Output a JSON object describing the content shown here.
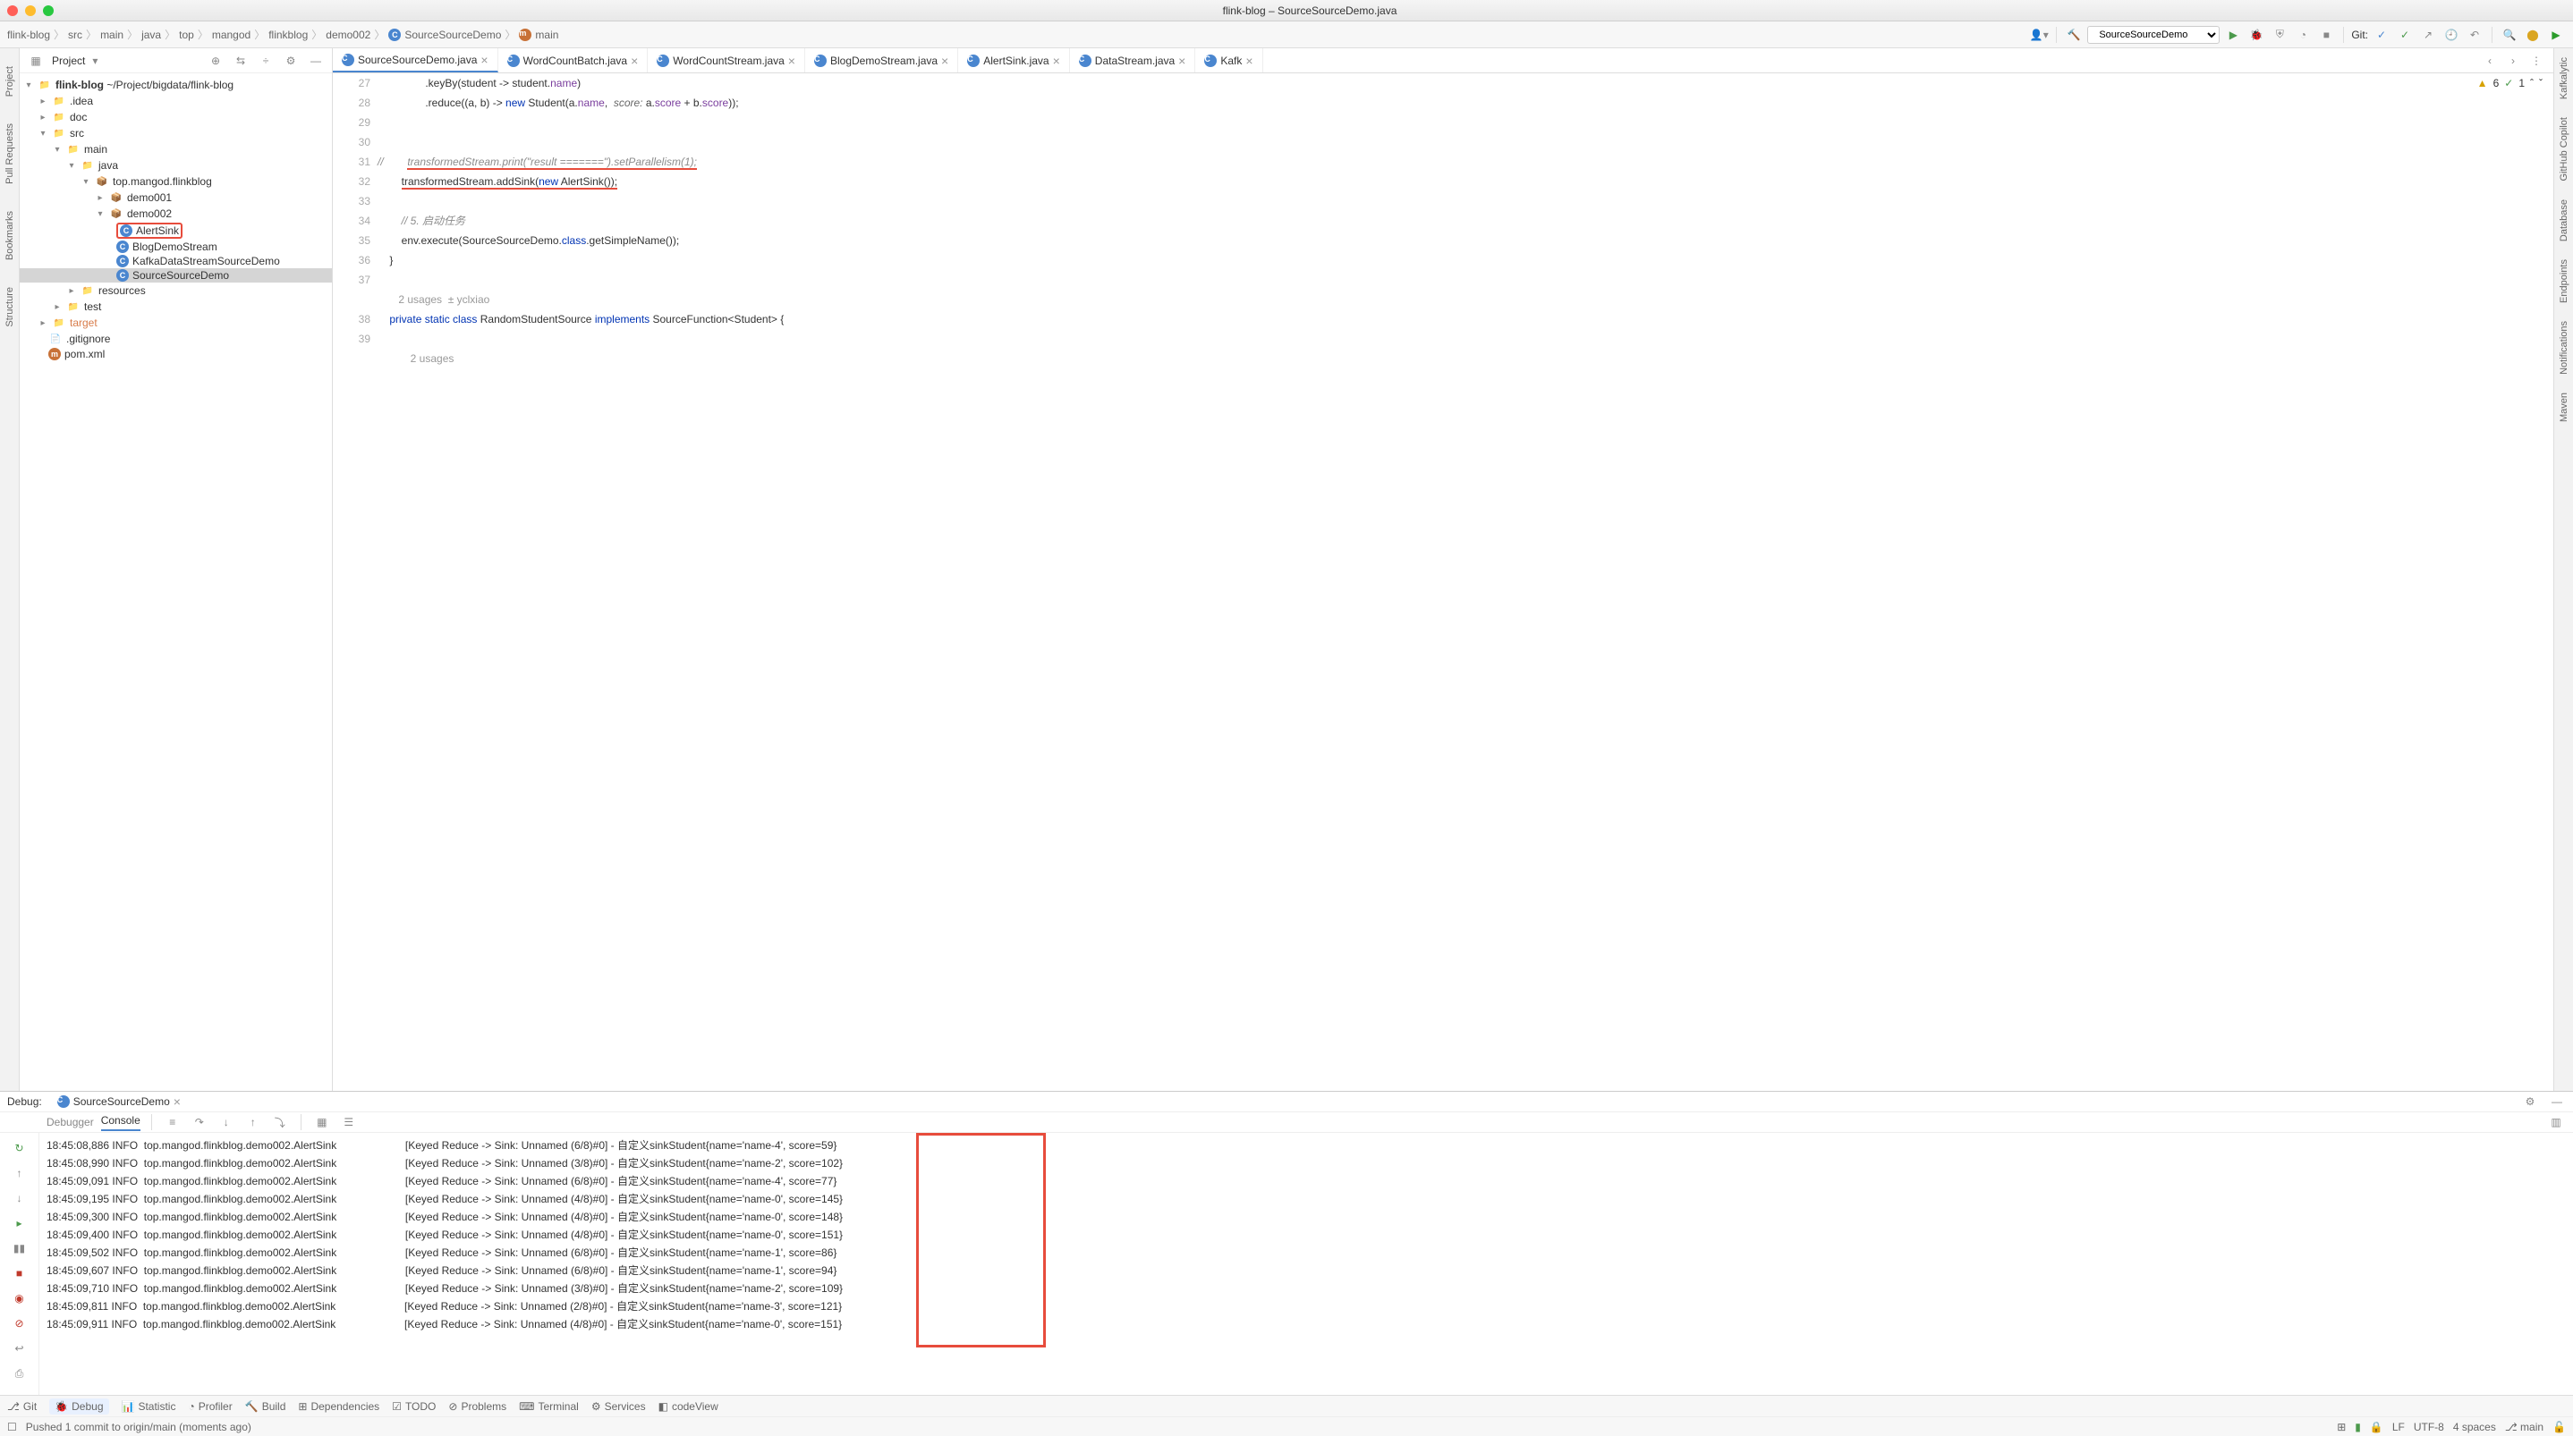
{
  "window": {
    "title": "flink-blog – SourceSourceDemo.java"
  },
  "breadcrumb": [
    "flink-blog",
    "src",
    "main",
    "java",
    "top",
    "mangod",
    "flinkblog",
    "demo002",
    "SourceSourceDemo",
    "main"
  ],
  "run_config": "SourceSourceDemo",
  "git_label": "Git:",
  "tabs": [
    {
      "label": "SourceSourceDemo.java",
      "active": true
    },
    {
      "label": "WordCountBatch.java",
      "active": false
    },
    {
      "label": "WordCountStream.java",
      "active": false
    },
    {
      "label": "BlogDemoStream.java",
      "active": false
    },
    {
      "label": "AlertSink.java",
      "active": false
    },
    {
      "label": "DataStream.java",
      "active": false
    },
    {
      "label": "Kafk",
      "active": false
    }
  ],
  "project_panel_title": "Project",
  "tree": {
    "root": "flink-blog",
    "root_path": "~/Project/bigdata/flink-blog",
    "items": [
      ".idea",
      "doc",
      "src",
      "main",
      "java",
      "top.mangod.flinkblog",
      "demo001",
      "demo002",
      "AlertSink",
      "BlogDemoStream",
      "KafkaDataStreamSourceDemo",
      "SourceSourceDemo",
      "resources",
      "test",
      "target",
      ".gitignore",
      "pom.xml"
    ]
  },
  "editor_widgets": {
    "warnings": "6",
    "ok": "1"
  },
  "code_lines": [
    {
      "n": 27,
      "html": "                .keyBy(student -> student.<span class='ident'>name</span>)"
    },
    {
      "n": 28,
      "html": "                .reduce((a, b) -> <span class='kw'>new</span> Student(a.<span class='ident'>name</span>,  <span class='param'>score:</span> a.<span class='ident'>score</span> + b.<span class='ident'>score</span>));"
    },
    {
      "n": 29,
      "html": ""
    },
    {
      "n": 30,
      "html": ""
    },
    {
      "n": 31,
      "html": "<span class='comment'>//        </span><span class='comment underline-red'>transformedStream.print(\"result =======\").setParallelism(1);</span>"
    },
    {
      "n": 32,
      "html": "        <span class='underline-red'>transformedStream.addSink(<span class='kw'>new</span> AlertSink());</span>"
    },
    {
      "n": 33,
      "html": ""
    },
    {
      "n": 34,
      "html": "        <span class='comment'>// 5. 启动任务</span>"
    },
    {
      "n": 35,
      "html": "        env.execute(SourceSourceDemo.<span class='kw'>class</span>.getSimpleName());"
    },
    {
      "n": 36,
      "html": "    }"
    },
    {
      "n": 37,
      "html": ""
    },
    {
      "n": 0,
      "html": "<span class='code-hint'>    2 usages  ± yclxiao</span>"
    },
    {
      "n": 38,
      "html": "    <span class='kw'>private static class</span> RandomStudentSource <span class='kw'>implements</span> SourceFunction&lt;Student&gt; {"
    },
    {
      "n": 39,
      "html": ""
    },
    {
      "n": 0,
      "html": "<span class='code-hint'>        2 usages</span>"
    }
  ],
  "debug": {
    "label": "Debug:",
    "config": "SourceSourceDemo",
    "tabs": {
      "debugger": "Debugger",
      "console": "Console"
    },
    "console_lines": [
      "18:45:08,886 INFO  top.mangod.flinkblog.demo002.AlertSink                       [Keyed Reduce -> Sink: Unnamed (6/8)#0] - 自定义sinkStudent{name='name-4', score=59}",
      "18:45:08,990 INFO  top.mangod.flinkblog.demo002.AlertSink                       [Keyed Reduce -> Sink: Unnamed (3/8)#0] - 自定义sinkStudent{name='name-2', score=102}",
      "18:45:09,091 INFO  top.mangod.flinkblog.demo002.AlertSink                       [Keyed Reduce -> Sink: Unnamed (6/8)#0] - 自定义sinkStudent{name='name-4', score=77}",
      "18:45:09,195 INFO  top.mangod.flinkblog.demo002.AlertSink                       [Keyed Reduce -> Sink: Unnamed (4/8)#0] - 自定义sinkStudent{name='name-0', score=145}",
      "18:45:09,300 INFO  top.mangod.flinkblog.demo002.AlertSink                       [Keyed Reduce -> Sink: Unnamed (4/8)#0] - 自定义sinkStudent{name='name-0', score=148}",
      "18:45:09,400 INFO  top.mangod.flinkblog.demo002.AlertSink                       [Keyed Reduce -> Sink: Unnamed (4/8)#0] - 自定义sinkStudent{name='name-0', score=151}",
      "18:45:09,502 INFO  top.mangod.flinkblog.demo002.AlertSink                       [Keyed Reduce -> Sink: Unnamed (6/8)#0] - 自定义sinkStudent{name='name-1', score=86}",
      "18:45:09,607 INFO  top.mangod.flinkblog.demo002.AlertSink                       [Keyed Reduce -> Sink: Unnamed (6/8)#0] - 自定义sinkStudent{name='name-1', score=94}",
      "18:45:09,710 INFO  top.mangod.flinkblog.demo002.AlertSink                       [Keyed Reduce -> Sink: Unnamed (3/8)#0] - 自定义sinkStudent{name='name-2', score=109}",
      "18:45:09,811 INFO  top.mangod.flinkblog.demo002.AlertSink                       [Keyed Reduce -> Sink: Unnamed (2/8)#0] - 自定义sinkStudent{name='name-3', score=121}",
      "18:45:09,911 INFO  top.mangod.flinkblog.demo002.AlertSink                       [Keyed Reduce -> Sink: Unnamed (4/8)#0] - 自定义sinkStudent{name='name-0', score=151}"
    ]
  },
  "status_tools": [
    "Git",
    "Debug",
    "Statistic",
    "Profiler",
    "Build",
    "Dependencies",
    "TODO",
    "Problems",
    "Terminal",
    "Services",
    "codeView"
  ],
  "status_msg": "Pushed 1 commit to origin/main (moments ago)",
  "status_right": {
    "eol": "LF",
    "encoding": "UTF-8",
    "indent": "4 spaces",
    "branch": "main"
  },
  "left_stripe": [
    "Project",
    "Pull Requests",
    "Bookmarks",
    "Structure"
  ],
  "right_stripe": [
    "Kafkalytic",
    "GitHub Copilot",
    "Database",
    "Endpoints",
    "Notifications",
    "Maven"
  ]
}
